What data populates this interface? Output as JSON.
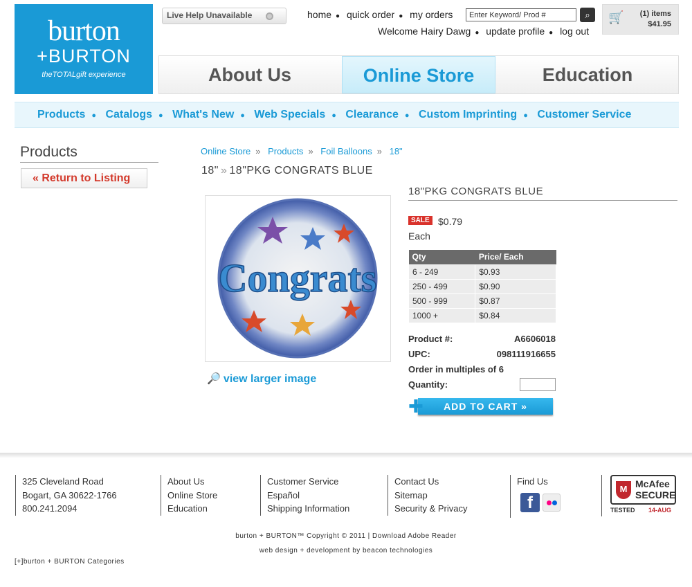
{
  "logo": {
    "line1": "burton",
    "line2": "+BURTON",
    "tagline": "theTOTALgift experience"
  },
  "livehelp": {
    "label": "Live Help Unavailable"
  },
  "toplinks": {
    "home": "home",
    "quick_order": "quick order",
    "my_orders": "my orders"
  },
  "welcome": {
    "text": "Welcome Hairy Dawg",
    "update": "update profile",
    "logout": "log out"
  },
  "search": {
    "placeholder": "Enter Keyword/ Prod #"
  },
  "cart": {
    "items": "(1) items",
    "amount": "$41.95"
  },
  "mainnav": {
    "about": "About Us",
    "store": "Online Store",
    "education": "Education"
  },
  "subnav": [
    "Products",
    "Catalogs",
    "What's New",
    "Web Specials",
    "Clearance",
    "Custom Imprinting",
    "Customer Service"
  ],
  "sidebar": {
    "title": "Products",
    "return": "« Return to Listing"
  },
  "breadcrumb": [
    "Online Store",
    "Products",
    "Foil Balloons",
    "18\""
  ],
  "pagetitle": {
    "category": "18\"",
    "product": "18\"PKG CONGRATS BLUE"
  },
  "product": {
    "name": "18\"PKG CONGRATS BLUE",
    "sale_badge": "SALE",
    "price": "$0.79",
    "unit": "Each",
    "image_text": "Congrats",
    "view_larger": "view larger image",
    "table_headers": [
      "Qty",
      "Price/ Each"
    ],
    "tiers": [
      {
        "qty": "6 - 249",
        "price": "$0.93"
      },
      {
        "qty": "250 - 499",
        "price": "$0.90"
      },
      {
        "qty": "500 - 999",
        "price": "$0.87"
      },
      {
        "qty": "1000 +",
        "price": "$0.84"
      }
    ],
    "product_label": "Product #:",
    "product_no": "A6606018",
    "upc_label": "UPC:",
    "upc": "098111916655",
    "multiples": "Order in multiples of 6",
    "quantity_label": "Quantity:",
    "add_to_cart": "ADD TO CART »"
  },
  "footer": {
    "address": [
      "325 Cleveland Road",
      "Bogart, GA 30622-1766",
      "800.241.2094"
    ],
    "col1": [
      "About Us",
      "Online Store",
      "Education"
    ],
    "col2": [
      "Customer Service",
      "Español",
      "Shipping Information"
    ],
    "col3": [
      "Contact Us",
      "Sitemap",
      "Security & Privacy"
    ],
    "findus": "Find Us",
    "mcafee": {
      "l1": "McAfee",
      "l2": "SECURE",
      "tested": "TESTED",
      "date": "14-AUG"
    },
    "copyright": "burton + BURTON™ Copyright © 2011 | Download Adobe Reader",
    "credit": "web design + development by beacon technologies",
    "categories": "[+]burton + BURTON Categories"
  },
  "colors": {
    "brand": "#1a9ad6",
    "sale": "#d9322b"
  }
}
